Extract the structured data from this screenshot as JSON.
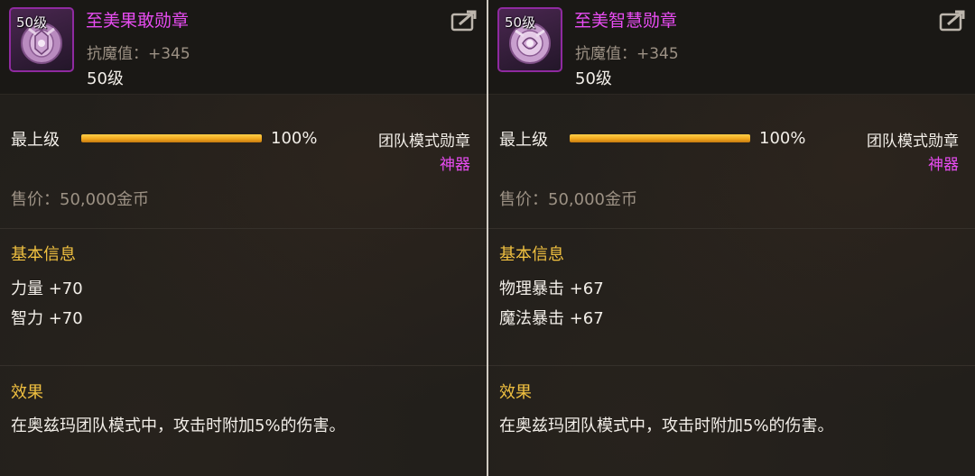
{
  "panels": [
    {
      "icon_level": "50级",
      "name": "至美果敢勋章",
      "stat": "抗魔值：+345",
      "level": "50级",
      "grade_label": "最上级",
      "grade_progress": 1.0,
      "grade_percent": "100%",
      "type": "团队模式勋章",
      "rarity": "神器",
      "price": "售价：50,000金币",
      "basic_title": "基本信息",
      "attributes": [
        "力量 +70",
        "智力 +70"
      ],
      "effect_title": "效果",
      "effect_text": "在奥兹玛团队模式中，攻击时附加5%的伤害。"
    },
    {
      "icon_level": "50级",
      "name": "至美智慧勋章",
      "stat": "抗魔值：+345",
      "level": "50级",
      "grade_label": "最上级",
      "grade_progress": 1.0,
      "grade_percent": "100%",
      "type": "团队模式勋章",
      "rarity": "神器",
      "price": "售价：50,000金币",
      "basic_title": "基本信息",
      "attributes": [
        "物理暴击 +67",
        "魔法暴击 +67"
      ],
      "effect_title": "效果",
      "effect_text": "在奥兹玛团队模式中，攻击时附加5%的伤害。"
    }
  ],
  "colors": {
    "name": "#e84cf2",
    "rarity": "#e84cf2",
    "section_title": "#f0c040",
    "bar": "#f2a81e"
  },
  "icons": {
    "medal": "medal-icon",
    "share": "share-icon"
  }
}
